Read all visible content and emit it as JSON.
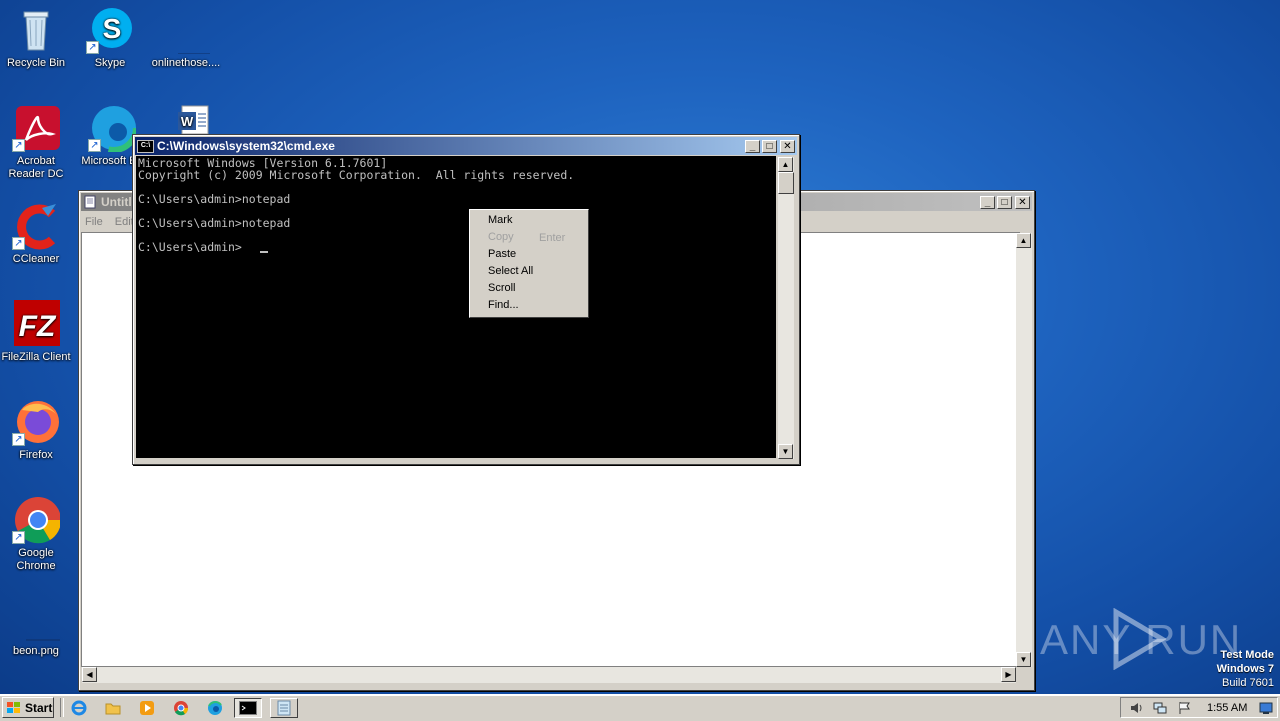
{
  "desktop": {
    "icons": [
      {
        "label": "Recycle Bin"
      },
      {
        "label": "Skype"
      },
      {
        "label": "onlinethose...."
      },
      {
        "label": "Acrobat Reader DC"
      },
      {
        "label": "Microsoft Ed"
      },
      {
        "label": "CCleaner"
      },
      {
        "label": "FileZilla Client"
      },
      {
        "label": "Firefox"
      },
      {
        "label": "Google Chrome"
      },
      {
        "label": "beon.png"
      }
    ],
    "watermark": {
      "brand": "ANY RUN",
      "line1": "Test Mode",
      "line2": "Windows 7",
      "line3": "Build 7601"
    }
  },
  "notepad": {
    "title": "Untitle",
    "menu": {
      "file": "File",
      "edit": "Edit"
    }
  },
  "cmd": {
    "title": "C:\\Windows\\system32\\cmd.exe",
    "icon_text": "C:\\",
    "lines": [
      "Microsoft Windows [Version 6.1.7601]",
      "Copyright (c) 2009 Microsoft Corporation.  All rights reserved.",
      "C:\\Users\\admin>notepad",
      "C:\\Users\\admin>notepad",
      "C:\\Users\\admin>"
    ]
  },
  "context_menu": {
    "items": [
      {
        "label": "Mark",
        "enabled": true
      },
      {
        "label": "Copy",
        "enabled": false,
        "accel": "Enter"
      },
      {
        "label": "Paste",
        "enabled": true
      },
      {
        "label": "Select All",
        "enabled": true
      },
      {
        "label": "Scroll",
        "enabled": true
      },
      {
        "label": "Find...",
        "enabled": true
      }
    ]
  },
  "taskbar": {
    "start_label": "Start",
    "clock": "1:55 AM"
  },
  "colors": {
    "title_active": "#0a246a",
    "title_inactive": "#808080",
    "desktop": "#1e63bf"
  }
}
